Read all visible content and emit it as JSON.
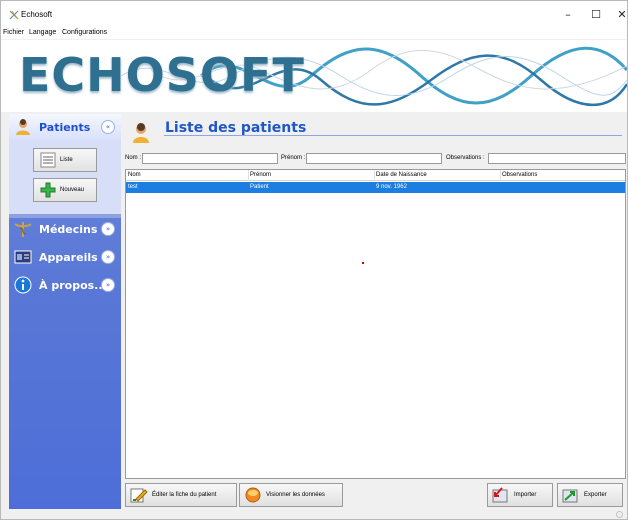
{
  "window": {
    "title": "Echosoft",
    "minimize": "–",
    "maximize": "☐",
    "close": "✕"
  },
  "menu": [
    "Fichier",
    "Langage",
    "Configurations"
  ],
  "banner": {
    "logo": "ECHOSOFT"
  },
  "sidebar": {
    "patients": {
      "label": "Patients",
      "buttons": {
        "list": "Liste",
        "new": "Nouveau"
      }
    },
    "medecins": {
      "label": "Médecins"
    },
    "appareils": {
      "label": "Appareils"
    },
    "apropos": {
      "label": "À propos..."
    },
    "expand_glyph": "»",
    "collapse_glyph": "«"
  },
  "content": {
    "title": "Liste des patients",
    "filters": {
      "nom_label": "Nom :",
      "prenom_label": "Prénom :",
      "observations_label": "Observations :",
      "nom_value": "",
      "prenom_value": "",
      "observations_value": ""
    },
    "table": {
      "columns": [
        "Nom",
        "Prénom",
        "Date de Naissance",
        "Observations"
      ],
      "rows": [
        {
          "nom": "test",
          "prenom": "Patient",
          "date": "9 nov. 1962",
          "observations": ""
        }
      ]
    }
  },
  "actions": {
    "edit": "Éditer la fiche du patient",
    "view": "Visionner les données",
    "import": "Importer",
    "export": "Exporter"
  },
  "colors": {
    "accent": "#1f57c8",
    "selection": "#1c7ee1",
    "sidebar": "#5a78d6"
  }
}
